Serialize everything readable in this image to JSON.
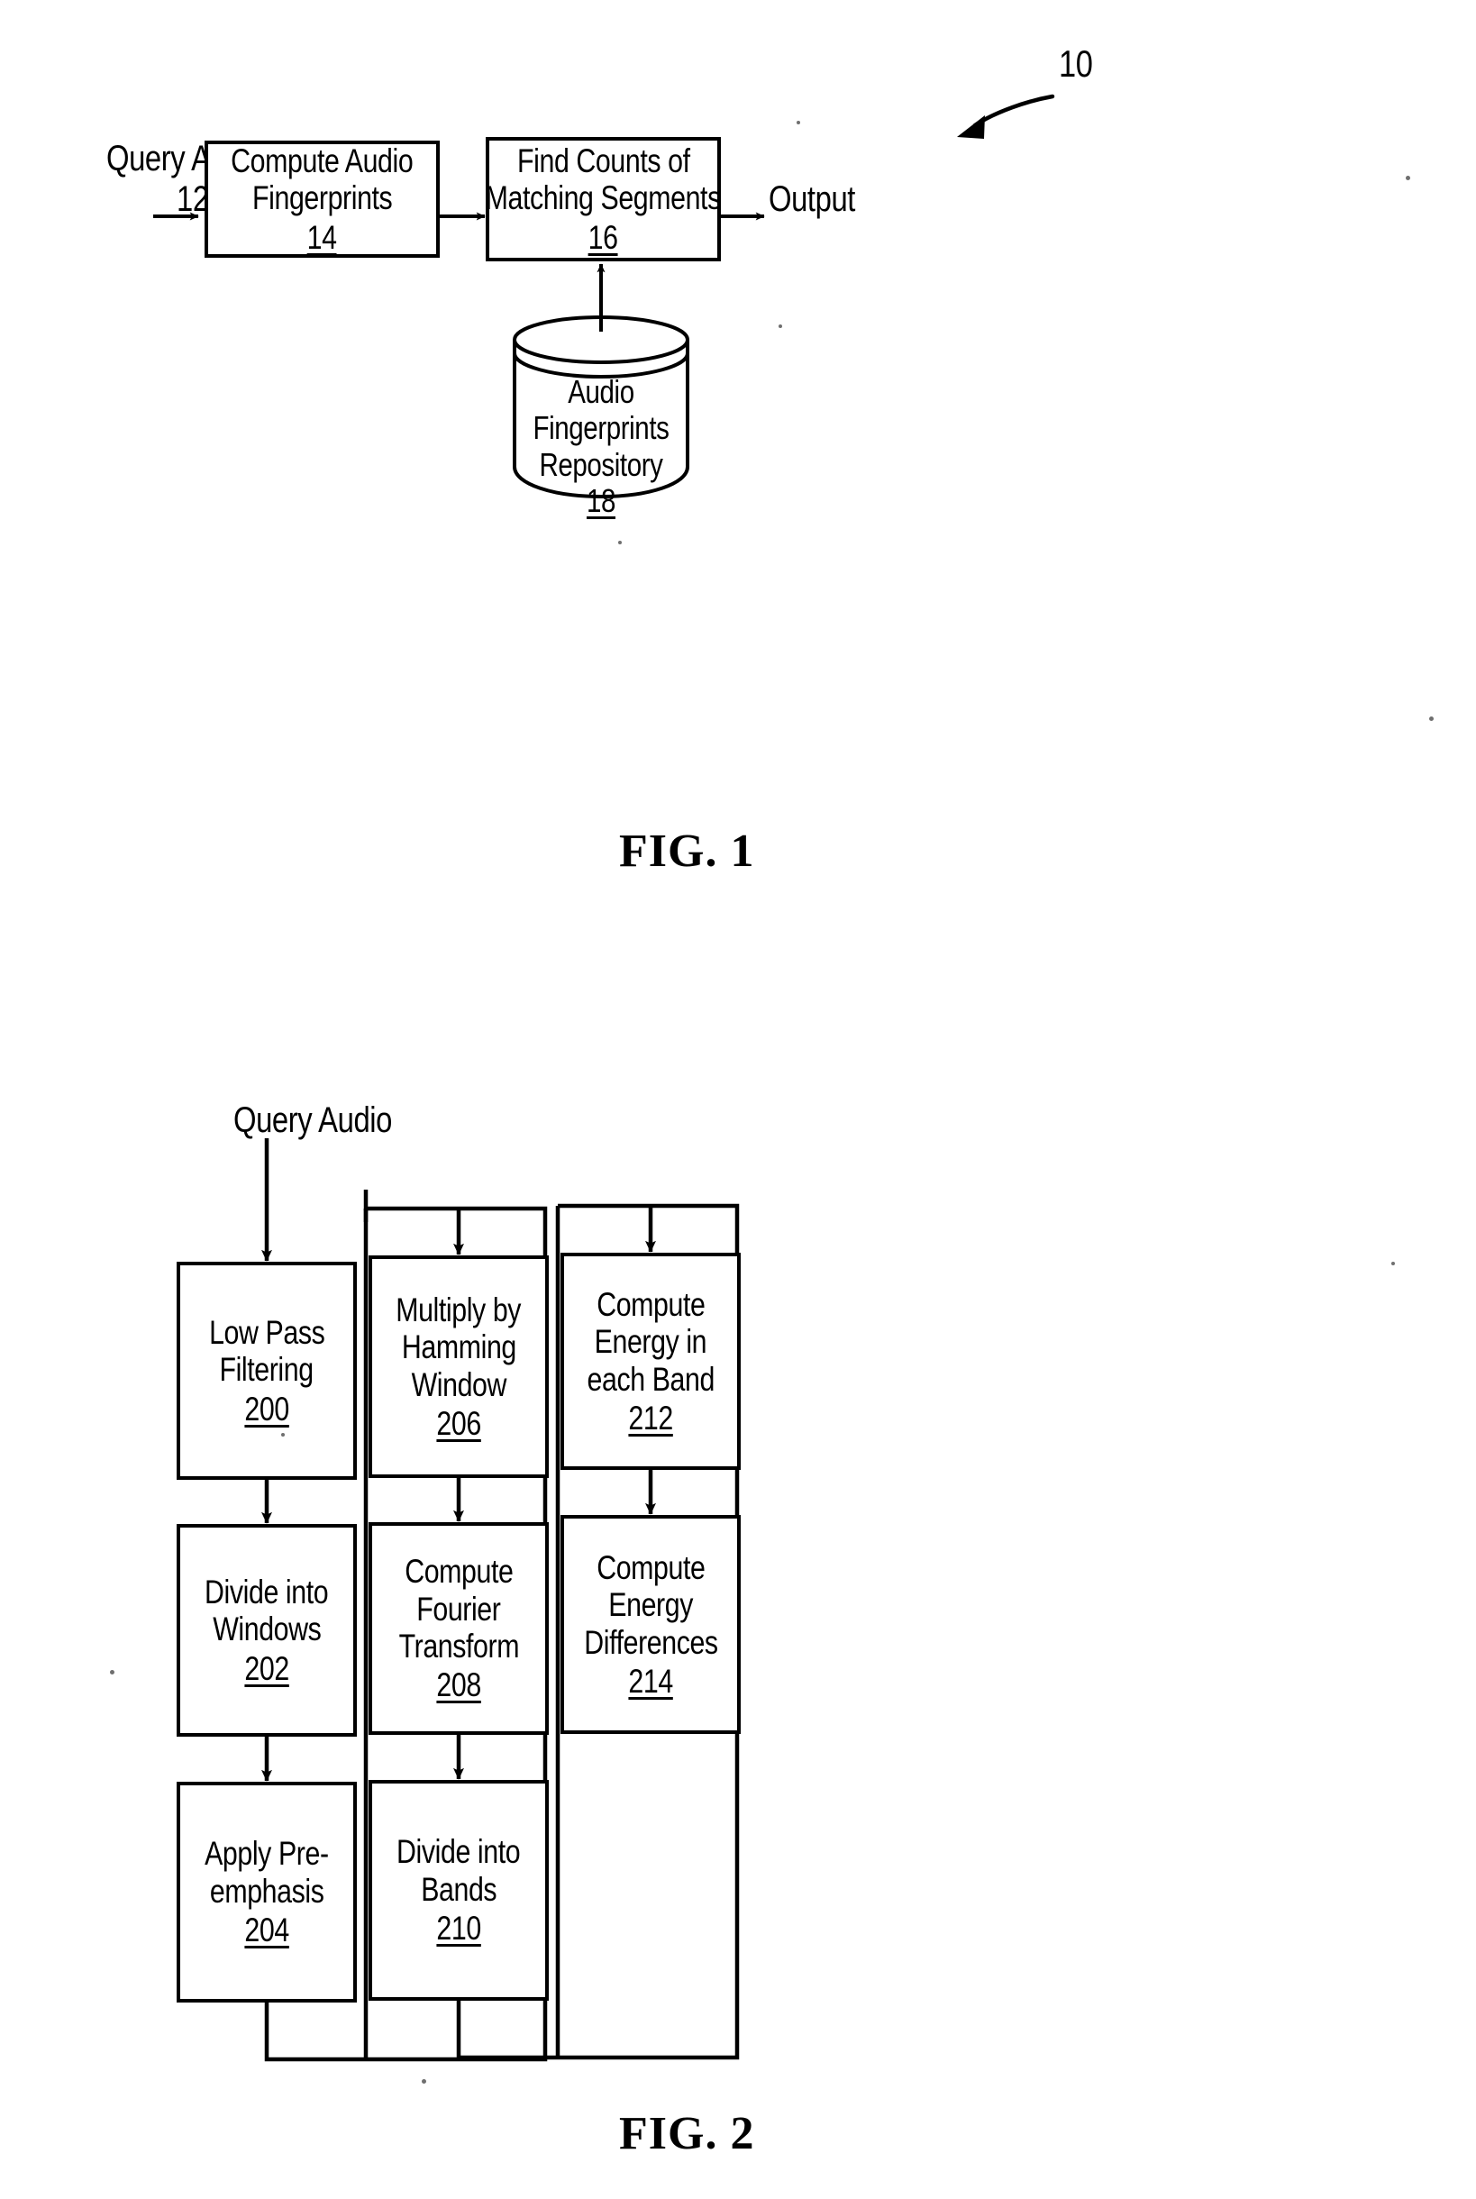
{
  "document": {
    "kind": "patent-drawing-sheet",
    "figures": [
      "FIG. 1",
      "FIG. 2"
    ]
  },
  "fig1": {
    "caption": "FIG. 1",
    "system_ref": "10",
    "input_label": "Query Audio",
    "input_ref": "12",
    "output_label": "Output",
    "boxes": [
      {
        "id": "compute-audio-fingerprints",
        "lines": [
          "Compute Audio",
          "Fingerprints"
        ],
        "ref": "14"
      },
      {
        "id": "find-counts-of-matching-segments",
        "lines": [
          "Find Counts of",
          "Matching Segments"
        ],
        "ref": "16"
      }
    ],
    "datastore": {
      "id": "audio-fingerprints-repository",
      "lines": [
        "Audio",
        "Fingerprints",
        "Repository"
      ],
      "ref": "18"
    }
  },
  "fig2": {
    "caption": "FIG. 2",
    "input_label": "Query Audio",
    "columns": [
      {
        "id": "column-1",
        "boxes": [
          {
            "id": "low-pass-filtering",
            "lines": [
              "Low Pass",
              "Filtering"
            ],
            "ref": "200"
          },
          {
            "id": "divide-into-windows",
            "lines": [
              "Divide into",
              "Windows"
            ],
            "ref": "202"
          },
          {
            "id": "apply-pre-emphasis",
            "lines": [
              "Apply Pre-",
              "emphasis"
            ],
            "ref": "204"
          }
        ]
      },
      {
        "id": "column-2",
        "boxes": [
          {
            "id": "multiply-by-hamming-window",
            "lines": [
              "Multiply by",
              "Hamming",
              "Window"
            ],
            "ref": "206"
          },
          {
            "id": "compute-fourier-transform",
            "lines": [
              "Compute",
              "Fourier",
              "Transform"
            ],
            "ref": "208"
          },
          {
            "id": "divide-into-bands",
            "lines": [
              "Divide into",
              "Bands"
            ],
            "ref": "210"
          }
        ]
      },
      {
        "id": "column-3",
        "boxes": [
          {
            "id": "compute-energy-in-each-band",
            "lines": [
              "Compute",
              "Energy in",
              "each Band"
            ],
            "ref": "212"
          },
          {
            "id": "compute-energy-differences",
            "lines": [
              "Compute",
              "Energy",
              "Differences"
            ],
            "ref": "214"
          }
        ]
      }
    ]
  },
  "colors": {
    "ink": "#000000",
    "paper": "#ffffff",
    "speck": "#6f6f6f"
  }
}
